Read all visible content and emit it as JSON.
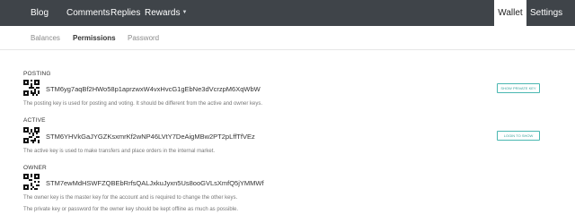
{
  "topnav": {
    "items": [
      {
        "label": "Blog"
      },
      {
        "label": "Comments"
      },
      {
        "label": "Replies"
      },
      {
        "label": "Rewards"
      },
      {
        "label": "Wallet"
      },
      {
        "label": "Settings"
      }
    ],
    "active": "Wallet"
  },
  "subnav": {
    "tabs": [
      {
        "label": "Balances"
      },
      {
        "label": "Permissions"
      },
      {
        "label": "Password"
      }
    ],
    "selected": "Permissions"
  },
  "keys": {
    "posting": {
      "heading": "POSTING",
      "key": "STM6yg7aqBf2HWo58p1aprzwxW4vxHvcG1gEbNe3dVcrzpM6XqWbW",
      "button": "SHOW PRIVATE KEY",
      "desc": "The posting key is used for posting and voting. It should be different from the active and owner keys."
    },
    "active": {
      "heading": "ACTIVE",
      "key": "STM6YHVkGaJYGZKsxmrKf2wNP46LVtY7DeAigMBw2PT2pLffTfVEz",
      "button": "LOGIN TO SHOW",
      "desc": "The active key is used to make transfers and place orders in the internal market."
    },
    "owner": {
      "heading": "OWNER",
      "key": "STM7ewMdHSWFZQBEbRrfsQALJxkuJyxn5Us8ooGVLsXmfQ5jYMMWf",
      "desc": "The owner key is the master key for the account and is required to change the other keys.",
      "desc2": "The private key or password for the owner key should be kept offline as much as possible."
    }
  },
  "colors": {
    "nav_bg": "#3f4449",
    "accent": "#4ab7b1"
  }
}
